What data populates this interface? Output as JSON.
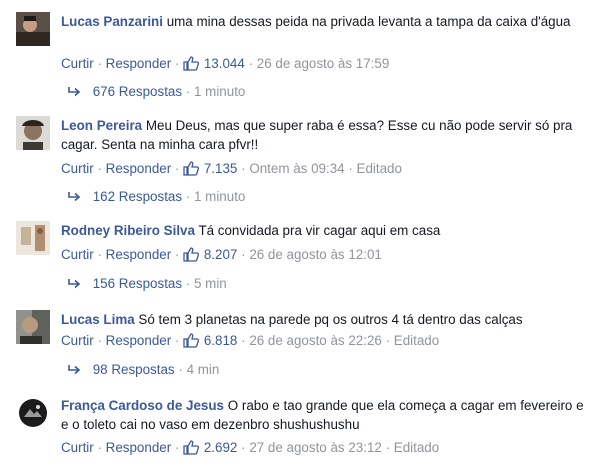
{
  "comments": [
    {
      "author": "Lucas Panzarini",
      "text": "uma mina dessas peida na privada levanta a tampa da caixa d'água",
      "like_label": "Curtir",
      "reply_label": "Responder",
      "likes": "13.044",
      "time": "26 de agosto às 17:59",
      "edited": "",
      "replies_count": "676 Respostas",
      "replies_time": "1 minuto"
    },
    {
      "author": "Leon Pereira",
      "text": "Meu Deus, mas que super raba é essa? Esse cu não pode servir só pra cagar. Senta na minha cara pfvr!!",
      "like_label": "Curtir",
      "reply_label": "Responder",
      "likes": "7.135",
      "time": "Ontem às 09:34",
      "edited": "Editado",
      "replies_count": "162 Respostas",
      "replies_time": "1 minuto"
    },
    {
      "author": "Rodney Ribeiro Silva",
      "text": "Tá convidada pra vir cagar aqui em casa",
      "like_label": "Curtir",
      "reply_label": "Responder",
      "likes": "8.207",
      "time": "26 de agosto às 12:01",
      "edited": "",
      "replies_count": "156 Respostas",
      "replies_time": "5 min"
    },
    {
      "author": "Lucas Lima",
      "text": "Só tem 3 planetas na parede pq os outros 4 tá dentro das calças",
      "like_label": "Curtir",
      "reply_label": "Responder",
      "likes": "6.818",
      "time": "26 de agosto às 22:26",
      "edited": "Editado",
      "replies_count": "98 Respostas",
      "replies_time": "4 min"
    },
    {
      "author": "França Cardoso de Jesus",
      "text": "O rabo e tao grande que ela começa a cagar em fevereiro e e o toleto cai no vaso em dezenbro shushushushu",
      "like_label": "Curtir",
      "reply_label": "Responder",
      "likes": "2.692",
      "time": "27 de agosto às 23:12",
      "edited": "Editado",
      "replies_count": "",
      "replies_time": ""
    }
  ],
  "separators": {
    "dot": "·"
  },
  "icons": {
    "like": "thumbs-up-icon",
    "reply": "reply-arrow-icon"
  },
  "colors": {
    "link": "#3b5998",
    "meta": "#90949c",
    "text": "#141823"
  }
}
